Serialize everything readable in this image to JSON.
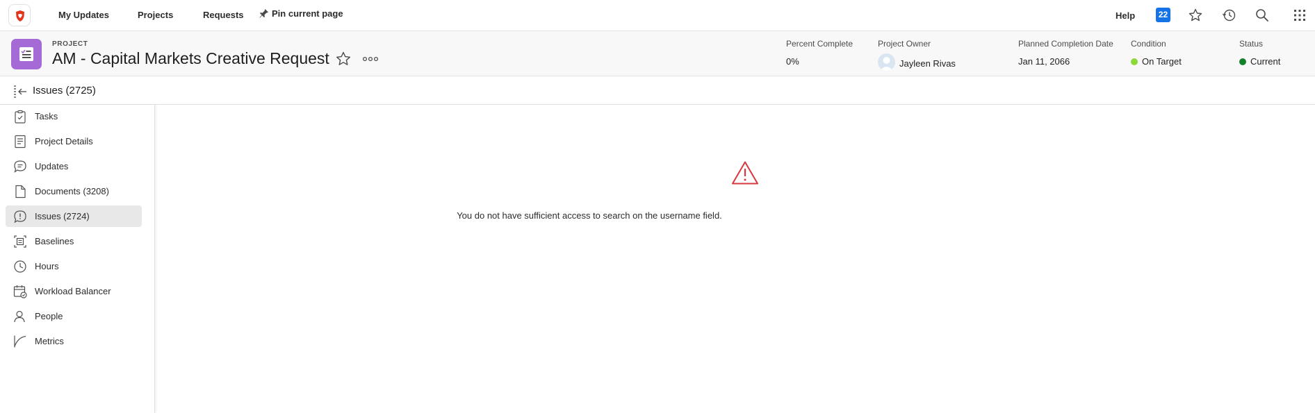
{
  "topnav": {
    "links": [
      "My Updates",
      "Projects",
      "Requests"
    ],
    "pin_label": "Pin current page",
    "help_label": "Help",
    "notification_count": "22"
  },
  "project": {
    "label": "PROJECT",
    "title": "AM - Capital Markets Creative Request",
    "percent_complete_label": "Percent Complete",
    "percent_complete": "0%",
    "owner_label": "Project Owner",
    "owner": "Jayleen Rivas",
    "planned_completion_label": "Planned Completion Date",
    "planned_completion": "Jan 11, 2066",
    "condition_label": "Condition",
    "condition": "On Target",
    "status_label": "Status",
    "status": "Current"
  },
  "section": {
    "title": "Issues (2725)"
  },
  "sidebar": {
    "items": [
      {
        "label": "Tasks",
        "icon": "tasks-icon"
      },
      {
        "label": "Project Details",
        "icon": "document-icon"
      },
      {
        "label": "Updates",
        "icon": "chat-icon"
      },
      {
        "label": "Documents (3208)",
        "icon": "file-icon"
      },
      {
        "label": "Issues (2724)",
        "icon": "issue-icon"
      },
      {
        "label": "Baselines",
        "icon": "baseline-icon"
      },
      {
        "label": "Hours",
        "icon": "clock-icon"
      },
      {
        "label": "Workload Balancer",
        "icon": "calendar-icon"
      },
      {
        "label": "People",
        "icon": "people-icon"
      },
      {
        "label": "Metrics",
        "icon": "chart-icon"
      }
    ],
    "active_index": 4
  },
  "main": {
    "message": "You do not have sufficient access to search on the username field."
  },
  "colors": {
    "accent": "#1473e6",
    "project_icon": "#a56ad6",
    "condition_dot": "#8ed93a",
    "status_dot": "#12812a",
    "warning": "#d7373f"
  }
}
